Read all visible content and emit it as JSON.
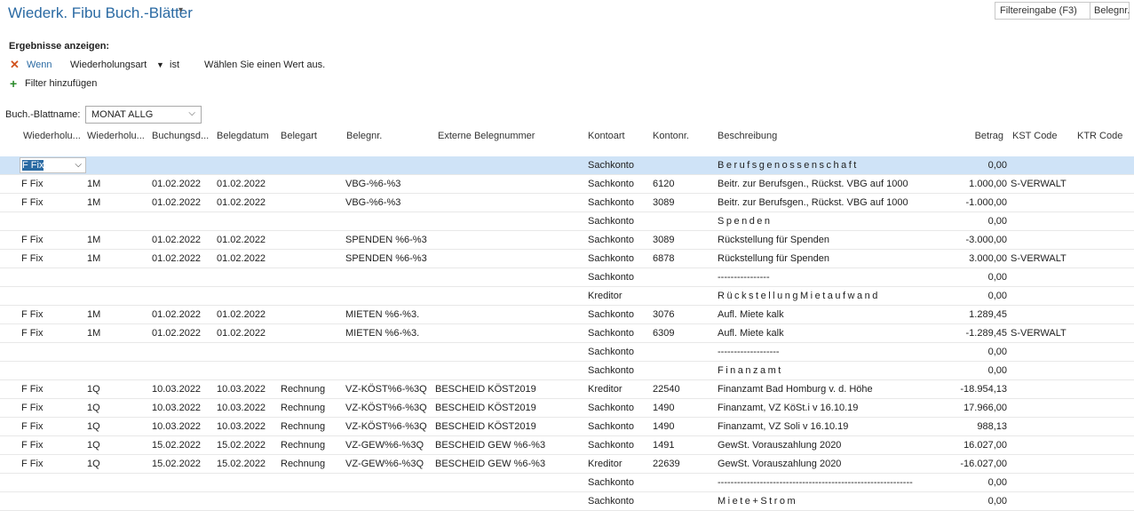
{
  "page": {
    "title": "Wiederk. Fibu Buch.-Blätter",
    "filter_placeholder": "Filtereingabe (F3)",
    "filter_field": "Belegnr."
  },
  "filters": {
    "results_label": "Ergebnisse anzeigen:",
    "when_label": "Wenn",
    "field": "Wiederholungsart",
    "operator": "ist",
    "value_placeholder": "Wählen Sie einen Wert aus.",
    "add_filter": "Filter hinzufügen"
  },
  "batch": {
    "label": "Buch.-Blattname:",
    "value": "MONAT ALLG"
  },
  "columns": [
    "Wiederholu...",
    "Wiederholu...",
    "Buchungsd...",
    "Belegdatum",
    "Belegart",
    "Belegnr.",
    "Externe Belegnummer",
    "Kontoart",
    "Kontonr.",
    "Beschreibung",
    "Betrag",
    "KST Code",
    "KTR Code"
  ],
  "rows": [
    {
      "method": "F Fix",
      "freq": "",
      "posting": "",
      "doc_date": "",
      "doc_type": "",
      "doc_no": "",
      "ext": "",
      "acct_type": "Sachkonto",
      "acct_no": "",
      "desc": "Berufsgenossenschaft",
      "amount": "0,00",
      "kst": "",
      "spaced": true,
      "selected": true
    },
    {
      "method": "F Fix",
      "freq": "1M",
      "posting": "01.02.2022",
      "doc_date": "01.02.2022",
      "doc_type": "",
      "doc_no": "VBG-%6-%3",
      "ext": "",
      "acct_type": "Sachkonto",
      "acct_no": "6120",
      "desc": "Beitr. zur Berufsgen., Rückst. VBG auf 1000",
      "amount": "1.000,00",
      "kst": "S-VERWALT"
    },
    {
      "method": "F Fix",
      "freq": "1M",
      "posting": "01.02.2022",
      "doc_date": "01.02.2022",
      "doc_type": "",
      "doc_no": "VBG-%6-%3",
      "ext": "",
      "acct_type": "Sachkonto",
      "acct_no": "3089",
      "desc": "Beitr. zur Berufsgen., Rückst. VBG auf 1000",
      "amount": "-1.000,00",
      "kst": ""
    },
    {
      "method": "",
      "freq": "",
      "posting": "",
      "doc_date": "",
      "doc_type": "",
      "doc_no": "",
      "ext": "",
      "acct_type": "Sachkonto",
      "acct_no": "",
      "desc": "Spenden",
      "amount": "0,00",
      "kst": "",
      "spaced": true
    },
    {
      "method": "F Fix",
      "freq": "1M",
      "posting": "01.02.2022",
      "doc_date": "01.02.2022",
      "doc_type": "",
      "doc_no": "SPENDEN %6-%3",
      "ext": "",
      "acct_type": "Sachkonto",
      "acct_no": "3089",
      "desc": "Rückstellung für Spenden",
      "amount": "-3.000,00",
      "kst": ""
    },
    {
      "method": "F Fix",
      "freq": "1M",
      "posting": "01.02.2022",
      "doc_date": "01.02.2022",
      "doc_type": "",
      "doc_no": "SPENDEN %6-%3",
      "ext": "",
      "acct_type": "Sachkonto",
      "acct_no": "6878",
      "desc": "Rückstellung für Spenden",
      "amount": "3.000,00",
      "kst": "S-VERWALT"
    },
    {
      "method": "",
      "freq": "",
      "posting": "",
      "doc_date": "",
      "doc_type": "",
      "doc_no": "",
      "ext": "",
      "acct_type": "Sachkonto",
      "acct_no": "",
      "desc": "----------------",
      "amount": "0,00",
      "kst": ""
    },
    {
      "method": "",
      "freq": "",
      "posting": "",
      "doc_date": "",
      "doc_type": "",
      "doc_no": "",
      "ext": "",
      "acct_type": "Kreditor",
      "acct_no": "",
      "desc": "RückstellungMietaufwand",
      "amount": "0,00",
      "kst": "",
      "spaced": true
    },
    {
      "method": "F Fix",
      "freq": "1M",
      "posting": "01.02.2022",
      "doc_date": "01.02.2022",
      "doc_type": "",
      "doc_no": "MIETEN %6-%3.",
      "ext": "",
      "acct_type": "Sachkonto",
      "acct_no": "3076",
      "desc": "Aufl. Miete kalk",
      "amount": "1.289,45",
      "kst": ""
    },
    {
      "method": "F Fix",
      "freq": "1M",
      "posting": "01.02.2022",
      "doc_date": "01.02.2022",
      "doc_type": "",
      "doc_no": "MIETEN %6-%3.",
      "ext": "",
      "acct_type": "Sachkonto",
      "acct_no": "6309",
      "desc": "Aufl. Miete kalk",
      "amount": "-1.289,45",
      "kst": "S-VERWALT"
    },
    {
      "method": "",
      "freq": "",
      "posting": "",
      "doc_date": "",
      "doc_type": "",
      "doc_no": "",
      "ext": "",
      "acct_type": "Sachkonto",
      "acct_no": "",
      "desc": "-------------------",
      "amount": "0,00",
      "kst": ""
    },
    {
      "method": "",
      "freq": "",
      "posting": "",
      "doc_date": "",
      "doc_type": "",
      "doc_no": "",
      "ext": "",
      "acct_type": "Sachkonto",
      "acct_no": "",
      "desc": "Finanzamt",
      "amount": "0,00",
      "kst": "",
      "spaced": true
    },
    {
      "method": "F Fix",
      "freq": "1Q",
      "posting": "10.03.2022",
      "doc_date": "10.03.2022",
      "doc_type": "Rechnung",
      "doc_no": "VZ-KÖST%6-%3Q",
      "ext": "BESCHEID KÖST2019",
      "acct_type": "Kreditor",
      "acct_no": "22540",
      "desc": "Finanzamt Bad Homburg v. d. Höhe",
      "amount": "-18.954,13",
      "kst": ""
    },
    {
      "method": "F Fix",
      "freq": "1Q",
      "posting": "10.03.2022",
      "doc_date": "10.03.2022",
      "doc_type": "Rechnung",
      "doc_no": "VZ-KÖST%6-%3Q",
      "ext": "BESCHEID KÖST2019",
      "acct_type": "Sachkonto",
      "acct_no": "1490",
      "desc": "Finanzamt, VZ KöSt.i v 16.10.19",
      "amount": "17.966,00",
      "kst": ""
    },
    {
      "method": "F Fix",
      "freq": "1Q",
      "posting": "10.03.2022",
      "doc_date": "10.03.2022",
      "doc_type": "Rechnung",
      "doc_no": "VZ-KÖST%6-%3Q",
      "ext": "BESCHEID KÖST2019",
      "acct_type": "Sachkonto",
      "acct_no": "1490",
      "desc": "Finanzamt, VZ Soli v 16.10.19",
      "amount": "988,13",
      "kst": ""
    },
    {
      "method": "F Fix",
      "freq": "1Q",
      "posting": "15.02.2022",
      "doc_date": "15.02.2022",
      "doc_type": "Rechnung",
      "doc_no": "VZ-GEW%6-%3Q",
      "ext": "BESCHEID GEW %6-%3",
      "acct_type": "Sachkonto",
      "acct_no": "1491",
      "desc": "GewSt. Vorauszahlung 2020",
      "amount": "16.027,00",
      "kst": ""
    },
    {
      "method": "F Fix",
      "freq": "1Q",
      "posting": "15.02.2022",
      "doc_date": "15.02.2022",
      "doc_type": "Rechnung",
      "doc_no": "VZ-GEW%6-%3Q",
      "ext": "BESCHEID GEW %6-%3",
      "acct_type": "Kreditor",
      "acct_no": "22639",
      "desc": "GewSt. Vorauszahlung 2020",
      "amount": "-16.027,00",
      "kst": ""
    },
    {
      "method": "",
      "freq": "",
      "posting": "",
      "doc_date": "",
      "doc_type": "",
      "doc_no": "",
      "ext": "",
      "acct_type": "Sachkonto",
      "acct_no": "",
      "desc": "------------------------------------------------------------",
      "amount": "0,00",
      "kst": ""
    },
    {
      "method": "",
      "freq": "",
      "posting": "",
      "doc_date": "",
      "doc_type": "",
      "doc_no": "",
      "ext": "",
      "acct_type": "Sachkonto",
      "acct_no": "",
      "desc": "Miete+Strom",
      "amount": "0,00",
      "kst": "",
      "spaced": true
    }
  ]
}
